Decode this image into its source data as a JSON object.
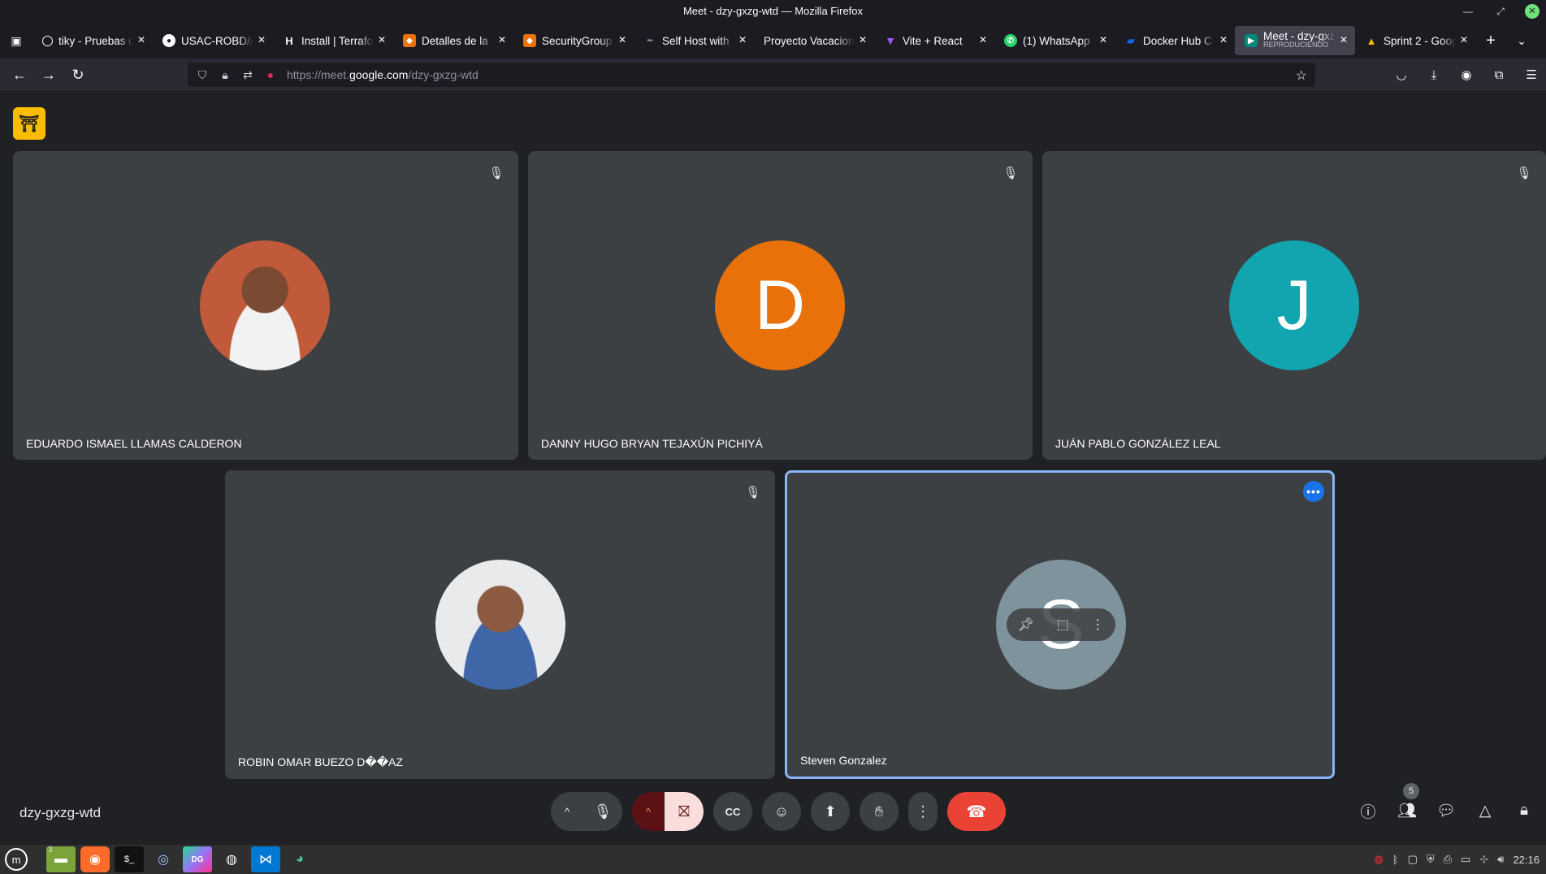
{
  "window": {
    "title": "Meet - dzy-gxzg-wtd — Mozilla Firefox"
  },
  "tabs": [
    {
      "title": "tiky - Pruebas de",
      "favicon": "openai-icon",
      "color": "#fbfbfe"
    },
    {
      "title": "USAC-ROBD/A",
      "favicon": "github-icon",
      "color": "#fbfbfe"
    },
    {
      "title": "Install | Terraform",
      "favicon": "hashicorp-icon",
      "color": "#fbfbfe"
    },
    {
      "title": "Detalles de la",
      "favicon": "aws-icon",
      "color": "#ed7100"
    },
    {
      "title": "SecurityGroup",
      "favicon": "aws-icon",
      "color": "#ed7100"
    },
    {
      "title": "Self Host with",
      "favicon": "dash-icon",
      "color": "#8f8f9d"
    },
    {
      "title": "Proyecto Vacacion",
      "favicon": "",
      "color": ""
    },
    {
      "title": "Vite + React",
      "favicon": "vite-icon",
      "color": "#a259ff"
    },
    {
      "title": "(1) WhatsApp",
      "favicon": "whatsapp-icon",
      "color": "#25d366"
    },
    {
      "title": "Docker Hub C",
      "favicon": "docker-icon",
      "color": "#1d63ed"
    },
    {
      "title": "Meet - dzy-gxzg",
      "subtitle": "REPRODUCIENDO",
      "favicon": "meet-icon",
      "color": "#00897b",
      "active": true
    },
    {
      "title": "Sprint 2 - Goog",
      "favicon": "drive-icon",
      "color": "#fbbc04"
    }
  ],
  "urlbar": {
    "url_prefix": "https://meet.",
    "url_domain": "google.com",
    "url_path": "/dzy-gxzg-wtd"
  },
  "meet": {
    "meeting_code": "dzy-gxzg-wtd",
    "participants_count": "5",
    "tiles": [
      {
        "name": "EDUARDO ISMAEL LLAMAS CALDERON",
        "avatar": "photo",
        "muted": true
      },
      {
        "name": "DANNY HUGO BRYAN TEJAXÚN PICHIYÁ",
        "avatar": "letter",
        "letter": "D",
        "color": "#e8710a",
        "muted": true
      },
      {
        "name": "JUÁN PABLO GONZÁLEZ LEAL",
        "avatar": "letter",
        "letter": "J",
        "color": "#12a4af",
        "muted": true
      },
      {
        "name": "ROBIN OMAR BUEZO D��AZ",
        "avatar": "photo",
        "muted": true
      },
      {
        "name": "Steven Gonzalez",
        "avatar": "letter",
        "letter": "S",
        "color": "#7f939d",
        "muted": false,
        "highlighted": true
      }
    ]
  },
  "taskbar": {
    "workspace_count": "3",
    "clock": "22:16"
  }
}
